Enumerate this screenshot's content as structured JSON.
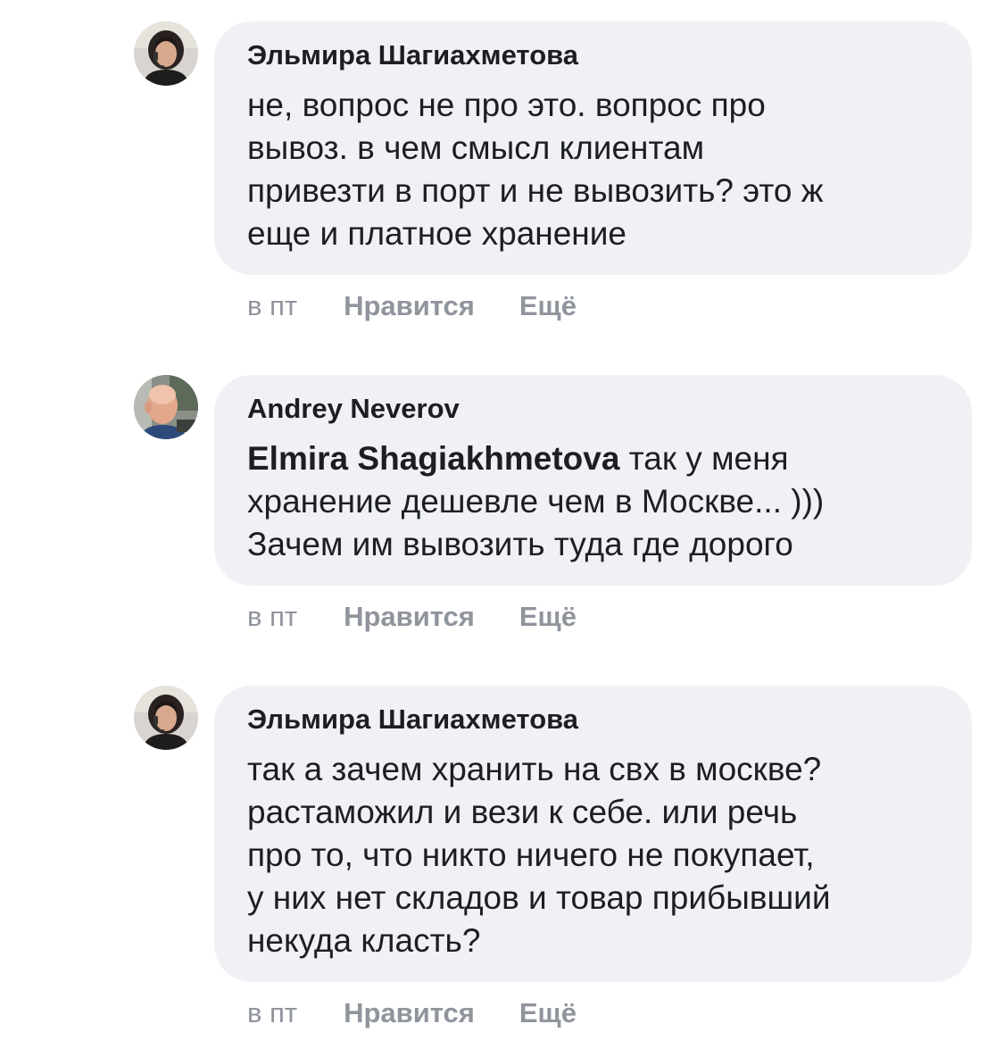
{
  "comments": [
    {
      "author": "Эльмира Шагиахметова",
      "avatar_icon": "user-avatar-woman-headset",
      "mention": "",
      "lines": [
        "не, вопрос не про это. вопрос про",
        "вывоз. в чем смысл клиентам",
        "привезти в порт и не вывозить? это ж",
        "еще и платное хранение"
      ],
      "time": "в пт",
      "like_label": "Нравится",
      "more_label": "Ещё"
    },
    {
      "author": "Andrey Neverov",
      "avatar_icon": "user-avatar-man-bald",
      "mention": "Elmira Shagiakhmetova",
      "lines": [
        " так у меня",
        "хранение дешевле чем в Москве... )))",
        "Зачем им вывозить туда где дорого"
      ],
      "time": "в пт",
      "like_label": "Нравится",
      "more_label": "Ещё"
    },
    {
      "author": "Эльмира Шагиахметова",
      "avatar_icon": "user-avatar-woman-headset",
      "mention": "",
      "lines": [
        "так а зачем хранить на свх в москве?",
        "растаможил и вези к себе. или речь",
        "про то, что никто ничего не покупает,",
        "у них нет складов и товар прибывший",
        "некуда класть?"
      ],
      "time": "в пт",
      "like_label": "Нравится",
      "more_label": "Ещё"
    }
  ],
  "colors": {
    "bubble_bg": "#eff1f4",
    "text": "#1c1e21",
    "meta": "#90949c"
  }
}
